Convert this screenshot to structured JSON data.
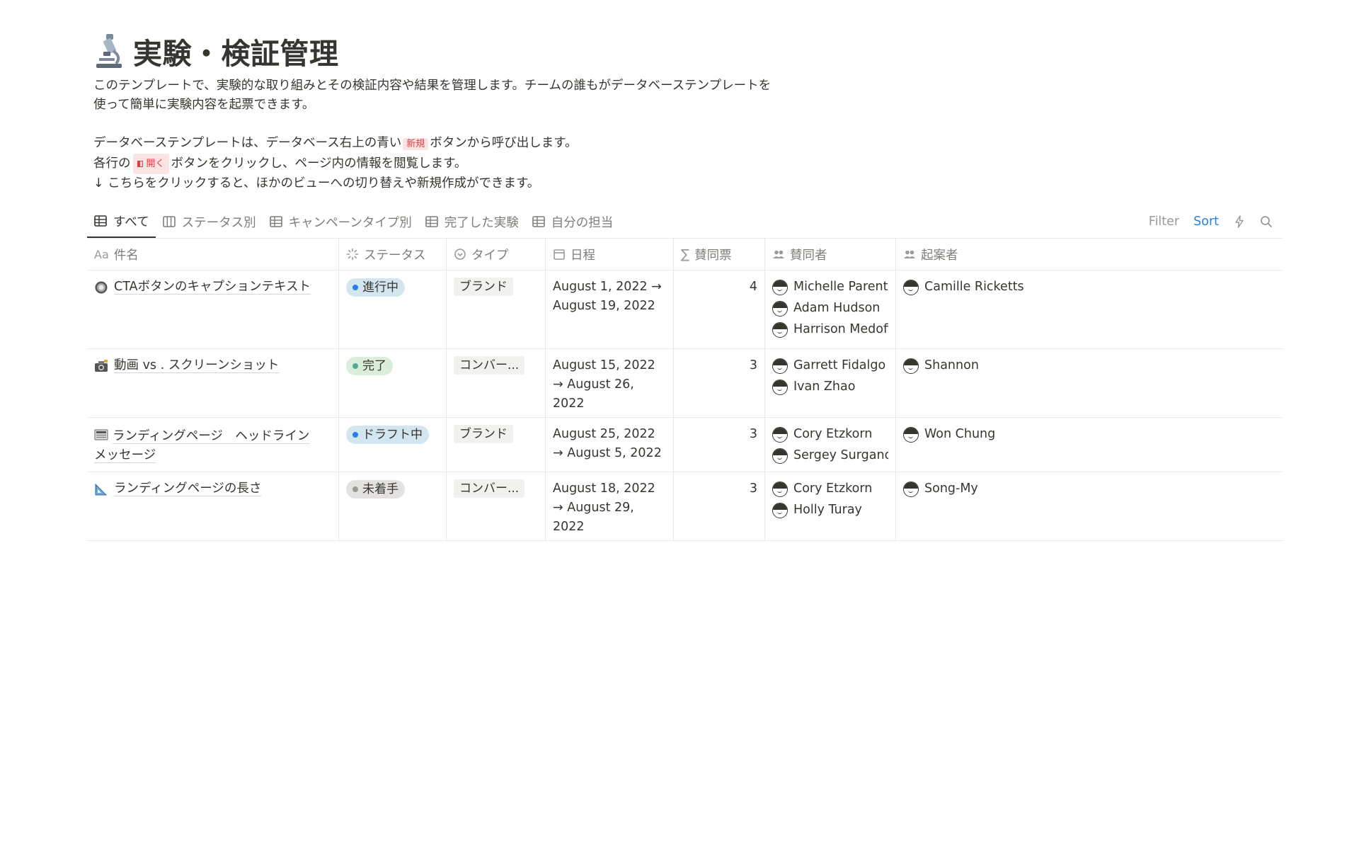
{
  "page": {
    "title": "実験・検証管理",
    "icon": "microscope-icon",
    "description": {
      "line1": "このテンプレートで、実験的な取り組みとその検証内容や結果を管理します。チームの誰もがデータベーステンプレートを",
      "line2": "使って簡単に実験内容を起票できます。",
      "line3_before": "データベーステンプレートは、データベース右上の青い",
      "line3_tag": "新規",
      "line3_after": "ボタンから呼び出します。",
      "line4_before": "各行の",
      "line4_tag": "開く",
      "line4_after": "ボタンをクリックし、ページ内の情報を閲覧します。",
      "line5": "↓ こちらをクリックすると、ほかのビューへの切り替えや新規作成ができます。"
    }
  },
  "views": {
    "tabs": [
      {
        "label": "すべて",
        "icon": "table-icon",
        "active": true
      },
      {
        "label": "ステータス別",
        "icon": "board-icon",
        "active": false
      },
      {
        "label": "キャンペーンタイプ別",
        "icon": "table-icon",
        "active": false
      },
      {
        "label": "完了した実験",
        "icon": "table-icon",
        "active": false
      },
      {
        "label": "自分の担当",
        "icon": "table-icon",
        "active": false
      }
    ],
    "filter_label": "Filter",
    "sort_label": "Sort"
  },
  "table": {
    "columns": [
      {
        "label": "件名",
        "prefix": "Aa",
        "icon": "title-icon"
      },
      {
        "label": "ステータス",
        "icon": "status-icon"
      },
      {
        "label": "タイプ",
        "icon": "select-icon"
      },
      {
        "label": "日程",
        "icon": "calendar-icon"
      },
      {
        "label": "賛同票",
        "icon": "formula-icon"
      },
      {
        "label": "賛同者",
        "icon": "people-icon"
      },
      {
        "label": "起案者",
        "icon": "people-icon"
      }
    ],
    "rows": [
      {
        "name": "CTAボタンのキャプションテキスト",
        "icon": "button-icon",
        "status": "進行中",
        "status_color": "#2383e2",
        "status_bg": "#d3e5ef",
        "type": "ブランド",
        "date_line1": "August 1, 2022 →",
        "date_line2": "August 19, 2022",
        "date_line3": "",
        "votes": "4",
        "supporters": [
          "Michelle Parent",
          "Adam Hudson",
          "Harrison Medoff"
        ],
        "proposer": "Camille Ricketts"
      },
      {
        "name": "動画 vs . スクリーンショット",
        "icon": "camera-icon",
        "status": "完了",
        "status_color": "#4dab9a",
        "status_bg": "#dbeddb",
        "type": "コンバー...",
        "date_line1": "August 15, 2022",
        "date_line2": "→ August 26,",
        "date_line3": "2022",
        "votes": "3",
        "supporters": [
          "Garrett Fidalgo",
          "Ivan Zhao"
        ],
        "proposer": "Shannon"
      },
      {
        "name_line1": "ランディングページ　ヘッドライン",
        "name_line2": "メッセージ",
        "icon": "newspaper-icon",
        "status": "ドラフト中",
        "status_color": "#2383e2",
        "status_bg": "#d3e5ef",
        "type": "ブランド",
        "date_line1": "August 25, 2022",
        "date_line2": "→ August 5, 2022",
        "date_line3": "",
        "votes": "3",
        "supporters": [
          "Cory Etzkorn",
          "Sergey Surganov"
        ],
        "proposer": "Won Chung"
      },
      {
        "name": "ランディングページの長さ",
        "icon": "ruler-icon",
        "status": "未着手",
        "status_color": "#9b9a97",
        "status_bg": "#e3e2e0",
        "type": "コンバー...",
        "date_line1": "August 18, 2022",
        "date_line2": "→ August 29,",
        "date_line3": "2022",
        "votes": "3",
        "supporters": [
          "Cory Etzkorn",
          "Holly Turay"
        ],
        "proposer": "Song-My"
      }
    ]
  }
}
